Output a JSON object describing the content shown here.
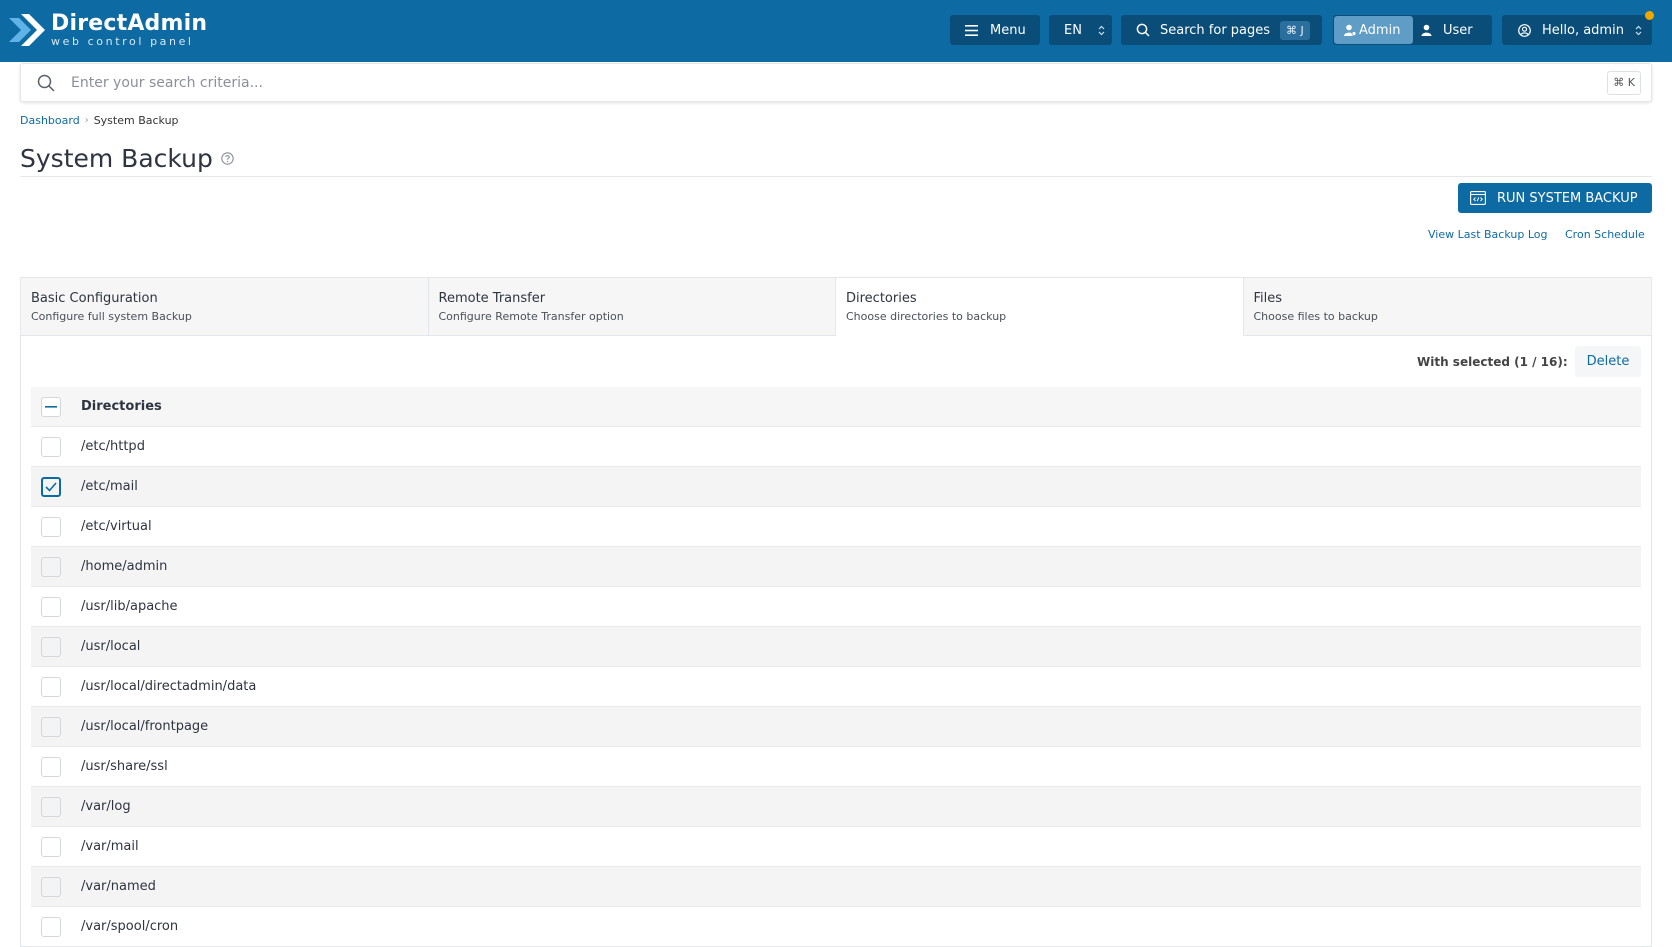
{
  "brand": {
    "title": "DirectAdmin",
    "subtitle": "web control panel"
  },
  "topbar": {
    "menu_label": "Menu",
    "language": "EN",
    "search_pages_label": "Search for pages",
    "search_pages_shortcut": "⌘ J",
    "role_admin": "Admin",
    "role_user": "User",
    "greeting": "Hello, admin"
  },
  "search": {
    "placeholder": "Enter your search criteria...",
    "shortcut": "⌘ K"
  },
  "breadcrumb": {
    "home": "Dashboard",
    "current": "System Backup"
  },
  "page": {
    "title": "System Backup"
  },
  "actions": {
    "run_backup": "RUN SYSTEM BACKUP",
    "view_log": "View Last Backup Log",
    "cron_schedule": "Cron Schedule"
  },
  "tabs": [
    {
      "title": "Basic Configuration",
      "subtitle": "Configure full system Backup"
    },
    {
      "title": "Remote Transfer",
      "subtitle": "Configure Remote Transfer option"
    },
    {
      "title": "Directories",
      "subtitle": "Choose directories to backup"
    },
    {
      "title": "Files",
      "subtitle": "Choose files to backup"
    }
  ],
  "active_tab": "Directories",
  "selection": {
    "label": "With selected (1 / 16):",
    "delete": "Delete"
  },
  "table": {
    "header": "Directories",
    "rows": [
      {
        "path": "/etc/httpd",
        "checked": false
      },
      {
        "path": "/etc/mail",
        "checked": true
      },
      {
        "path": "/etc/virtual",
        "checked": false
      },
      {
        "path": "/home/admin",
        "checked": false
      },
      {
        "path": "/usr/lib/apache",
        "checked": false
      },
      {
        "path": "/usr/local",
        "checked": false
      },
      {
        "path": "/usr/local/directadmin/data",
        "checked": false
      },
      {
        "path": "/usr/local/frontpage",
        "checked": false
      },
      {
        "path": "/usr/share/ssl",
        "checked": false
      },
      {
        "path": "/var/log",
        "checked": false
      },
      {
        "path": "/var/mail",
        "checked": false
      },
      {
        "path": "/var/named",
        "checked": false
      },
      {
        "path": "/var/spool/cron",
        "checked": false
      }
    ]
  },
  "colors": {
    "brand_blue": "#0e6aa3",
    "topbar_dark": "#0a4d79",
    "notification": "#f0a800"
  }
}
